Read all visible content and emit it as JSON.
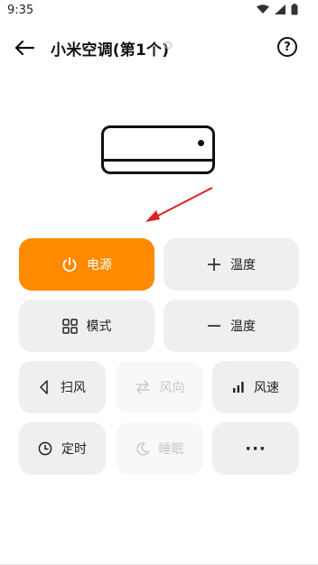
{
  "status_bar": {
    "time": "9:35"
  },
  "header": {
    "title": "小米空调(第1个)",
    "help_label": "?"
  },
  "controls": {
    "power": "电源",
    "temp_up": "温度",
    "mode": "模式",
    "temp_down": "温度",
    "swing": "扫风",
    "direction": "风向",
    "speed": "风速",
    "timer": "定时",
    "sleep": "睡眠",
    "more": "···"
  },
  "colors": {
    "accent": "#ff8a00",
    "arrow": "#e02020",
    "tile": "#efefef"
  }
}
